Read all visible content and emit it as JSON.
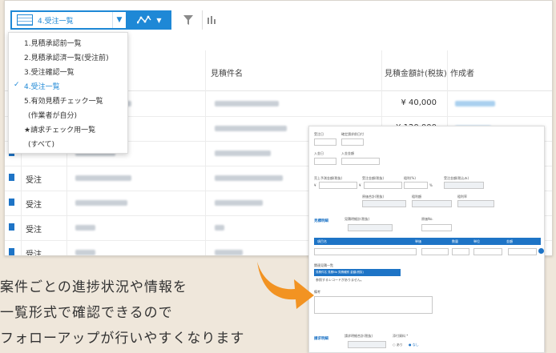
{
  "toolbar": {
    "view_selected": "4.受注一覧",
    "chevron": "⌄",
    "chart_icon": "line-chart-icon",
    "filter_icon": "funnel-icon",
    "column_icon": "columns-icon"
  },
  "view_menu": {
    "items": [
      {
        "label": "1.見積承認前一覧",
        "selected": false
      },
      {
        "label": "2.見積承認済一覧(受注前)",
        "selected": false
      },
      {
        "label": "3.受注確認一覧",
        "selected": false
      },
      {
        "label": "4.受注一覧",
        "selected": true
      },
      {
        "label": "5.有効見積チェック一覧",
        "selected": false
      },
      {
        "label": "(作業者が自分)",
        "selected": false
      },
      {
        "label": "★請求チェック用一覧",
        "selected": false
      },
      {
        "label": "(すべて)",
        "selected": false
      }
    ],
    "check_mark": "✓"
  },
  "table": {
    "headers": {
      "name": "見積件名",
      "amount": "見積金額計(税抜)",
      "author": "作成者"
    },
    "rows": [
      {
        "type": "",
        "amount": "¥ 40,000"
      },
      {
        "type": "",
        "amount": "¥ 120,000"
      },
      {
        "type": "",
        "amount": ""
      },
      {
        "type": "受注",
        "amount": ""
      },
      {
        "type": "受注",
        "amount": ""
      },
      {
        "type": "受注",
        "amount": ""
      },
      {
        "type": "受注",
        "amount": ""
      }
    ]
  },
  "form": {
    "labels": {
      "l1": "受注日",
      "l2": "確定請求前日付",
      "l3": "入金日",
      "l4": "入金金額",
      "l5": "売上予測金額(税抜)",
      "l6": "受注金額(税抜)",
      "l7": "粗利(%)",
      "l8": "受注金額(税込み)",
      "l9": "原価合計(税抜)",
      "l10": "粗利額",
      "l11": "粗利率",
      "l12": "見積明細計(税抜)",
      "l13": "原価No.",
      "t1": "項目名",
      "t2": "単価",
      "t3": "数量",
      "t4": "単位",
      "t5": "金額",
      "rel": "関連見積一覧",
      "relcols": "見積件名  見積No  見積種別  金額(税抜)",
      "relnone": "参照するレコードがありません。",
      "memo": "備考",
      "l14": "請求明細合計(税抜)",
      "l15": "添付資料 *",
      "opt1": "あり",
      "opt2": "なし"
    },
    "sections": {
      "s1": "見積明細",
      "s2": "請求明細"
    },
    "unit_yen": "¥",
    "unit_pct": "%"
  },
  "caption": {
    "line1": "案件ごとの進捗状況や情報を",
    "line2": "一覧形式で確認できるので",
    "line3": "フォローアップが行いやすくなります"
  },
  "colors": {
    "accent": "#1e88d6",
    "arrow": "#f29322",
    "background": "#efe7db"
  }
}
